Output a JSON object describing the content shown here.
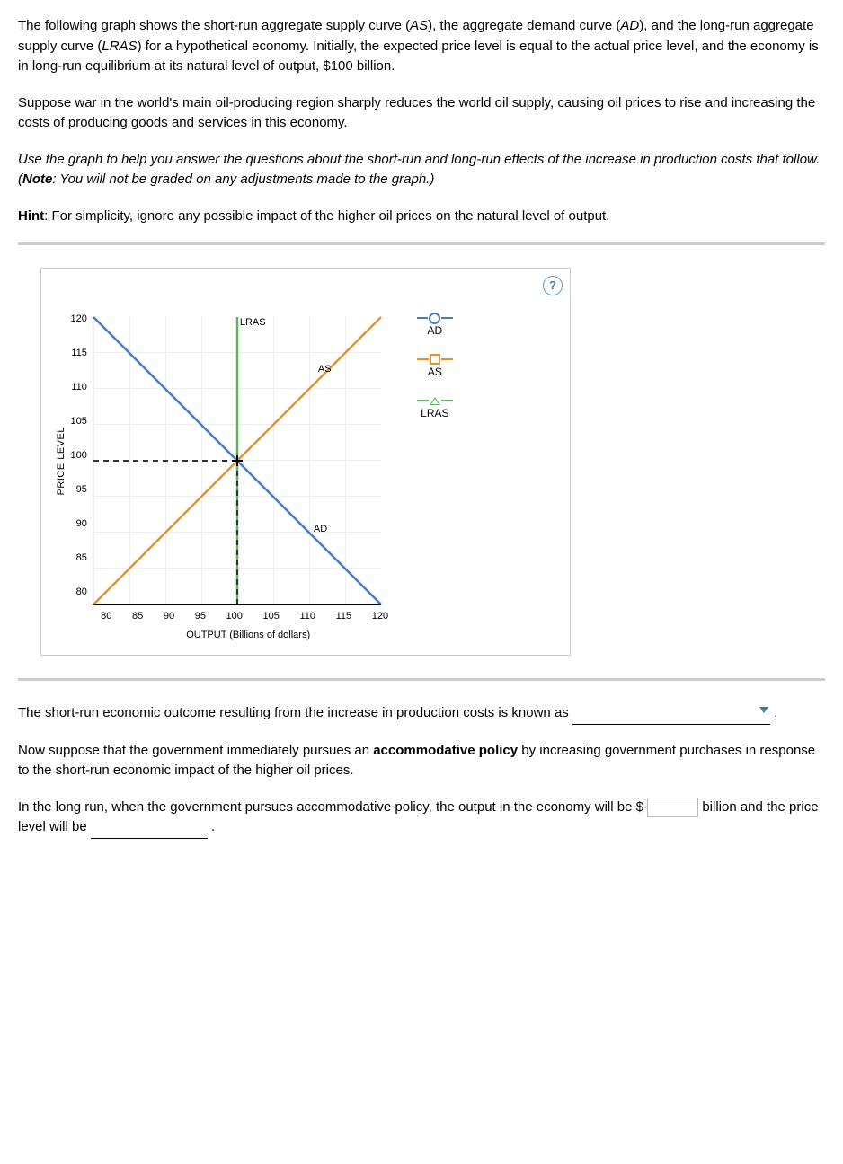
{
  "paragraphs": {
    "p1_a": "The following graph shows the short-run aggregate supply curve (",
    "p1_as": "AS",
    "p1_b": "), the aggregate demand curve (",
    "p1_ad": "AD",
    "p1_c": "), and the long-run aggregate supply curve (",
    "p1_lras": "LRAS",
    "p1_d": ") for a hypothetical economy. Initially, the expected price level is equal to the actual price level, and the economy is in long-run equilibrium at its natural level of output, $100 billion.",
    "p2": "Suppose war in the world's main oil-producing region sharply reduces the world oil supply, causing oil prices to rise and increasing the costs of producing goods and services in this economy.",
    "p3_a": "Use the graph to help you answer the questions about the short-run and long-run effects of the increase in production costs that follow. (",
    "p3_note": "Note",
    "p3_b": ": You will not be graded on any adjustments made to the graph.)",
    "p4_hint": "Hint",
    "p4": ": For simplicity, ignore any possible impact of the higher oil prices on the natural level of output.",
    "p5": "The short-run economic outcome resulting from the increase in production costs is known as",
    "p5_end": ".",
    "p6_a": "Now suppose that the government immediately pursues an ",
    "p6_bold": "accommodative policy",
    "p6_b": " by increasing government purchases in response to the short-run economic impact of the higher oil prices.",
    "p7_a": "In the long run, when the government pursues accommodative policy, the output in the economy will be ",
    "p7_dollar": "$",
    "p7_b": " billion and the price level will be",
    "p7_end": "."
  },
  "chart_data": {
    "type": "line",
    "xlabel": "OUTPUT (Billions of dollars)",
    "ylabel": "PRICE LEVEL",
    "xlim": [
      80,
      120
    ],
    "ylim": [
      80,
      120
    ],
    "xticks": [
      80,
      85,
      90,
      95,
      100,
      105,
      110,
      115,
      120
    ],
    "yticks": [
      80,
      85,
      90,
      95,
      100,
      105,
      110,
      115,
      120
    ],
    "series": [
      {
        "name": "AD",
        "color": "#4a7bb5",
        "x": [
          80,
          120
        ],
        "y": [
          120,
          80
        ]
      },
      {
        "name": "AS",
        "color": "#e8912c",
        "x": [
          80,
          120
        ],
        "y": [
          80,
          120
        ]
      },
      {
        "name": "LRAS",
        "color": "#5fb661",
        "x": [
          100,
          100
        ],
        "y": [
          80,
          120
        ]
      }
    ],
    "guides": {
      "h_dashed_y": 100,
      "h_dashed_x_range": [
        80,
        100
      ],
      "v_dashed_x": 100,
      "v_dashed_y_range": [
        80,
        100
      ]
    },
    "labels_on_plot": {
      "LRAS": "LRAS",
      "AS": "AS",
      "AD": "AD"
    }
  },
  "legend": {
    "ad": "AD",
    "as": "AS",
    "lras": "LRAS"
  },
  "help": "?"
}
